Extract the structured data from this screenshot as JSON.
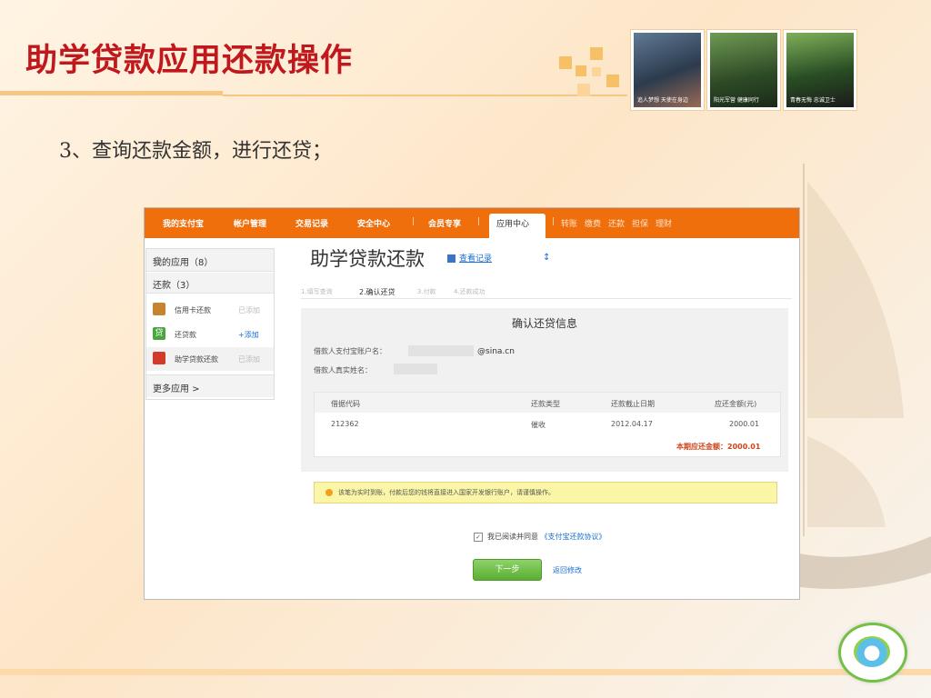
{
  "slide": {
    "title": "助学贷款应用还款操作",
    "subtitle": "3、查询还款金额，进行还贷；",
    "photos": [
      {
        "caption": "追人梦想 天使在身边"
      },
      {
        "caption": "阳光军营 健康同行"
      },
      {
        "caption": "青春无悔 忠诚卫士"
      }
    ]
  },
  "nav": {
    "items": [
      "我的支付宝",
      "帐户管理",
      "交易记录",
      "安全中心",
      "|",
      "会员专享",
      "|"
    ],
    "active": "应用中心",
    "links": [
      "|",
      "转账",
      "缴费",
      "还款",
      "担保",
      "理财"
    ]
  },
  "sidebar": {
    "my_apps": "我的应用（8）",
    "repay_section": "还款（3）",
    "apps": [
      {
        "label": "信用卡还款",
        "action": "已添加",
        "color": "#c7832f"
      },
      {
        "label": "还贷款",
        "action": "+添加",
        "color": "#4ca640",
        "glyph": "贷"
      },
      {
        "label": "助学贷款还款",
        "action": "已添加",
        "color": "#d23b2a"
      }
    ],
    "more": "更多应用 >"
  },
  "main": {
    "title": "助学贷款还款",
    "view_records": "查看记录",
    "stray_char": "↕",
    "steps": [
      "1.填写查询",
      "2.确认还贷",
      "3.付款",
      "4.还款成功"
    ],
    "panel_title": "确认还贷信息",
    "account_label": "借款人支付宝账户名：",
    "account_value": "@sina.cn",
    "name_label": "借款人真实姓名：",
    "table": {
      "headers": [
        "借据代码",
        "还款类型",
        "还款截止日期",
        "应还金额(元)"
      ],
      "rows": [
        [
          "212362",
          "催收",
          "2012.04.17",
          "2000.01"
        ]
      ],
      "total": "本期应还金额：2000.01"
    },
    "notice": "该笔为实时到账，付款后您的钱将直接进入国家开发银行账户，请谨慎操作。",
    "agree_prefix": "我已阅读并同意",
    "agree_link": "《支付宝还款协议》",
    "next": "下一步",
    "back": "返回修改"
  }
}
